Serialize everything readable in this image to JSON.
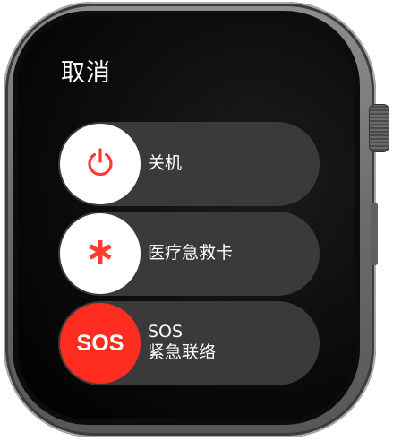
{
  "header": {
    "cancel_label": "取消"
  },
  "sliders": [
    {
      "label": "关机",
      "icon": "power-icon",
      "icon_color": "#ff3b30"
    },
    {
      "label": "医疗急救卡",
      "icon": "medical-asterisk-icon",
      "icon_color": "#ff3b30"
    },
    {
      "label_line1": "SOS",
      "label_line2": "紧急联络",
      "knob_text": "SOS",
      "knob_color": "#ff2d20"
    }
  ],
  "colors": {
    "screen_background": "#000000",
    "slider_track": "#3a3a3c",
    "accent_red": "#ff3b30",
    "text": "#ffffff"
  }
}
